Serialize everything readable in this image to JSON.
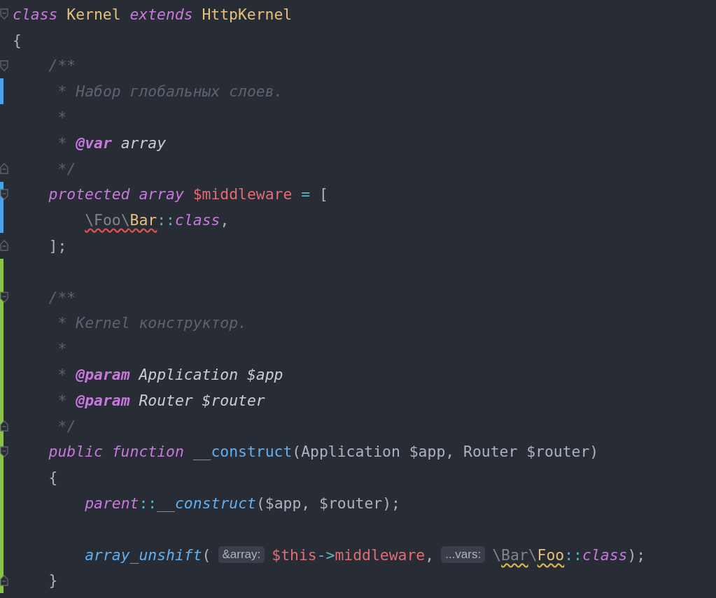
{
  "editor": {
    "lines": [
      {
        "kind": "top",
        "modified": false,
        "added": false,
        "fold_start": true,
        "fold_end": false,
        "segments": [
          {
            "kind": "code",
            "tokens": [
              {
                "text": "class ",
                "kind": "keyword"
              },
              {
                "text": "Kernel ",
                "kind": "class"
              },
              {
                "text": "extends ",
                "kind": "keyword"
              },
              {
                "text": "HttpKernel",
                "kind": "class"
              }
            ]
          }
        ]
      },
      {
        "kind": "top",
        "modified": false,
        "added": false,
        "fold_start": false,
        "fold_end": false,
        "segments": [
          {
            "kind": "code",
            "tokens": [
              {
                "text": "{",
                "kind": "punct"
              }
            ]
          }
        ]
      },
      {
        "kind": "member",
        "modified": false,
        "added": false,
        "fold_start": true,
        "fold_end": false,
        "segments": [
          {
            "kind": "code",
            "tokens": [
              {
                "text": "/**",
                "kind": "comment"
              }
            ]
          }
        ]
      },
      {
        "kind": "doc",
        "modified": true,
        "added": false,
        "fold_start": false,
        "fold_end": false,
        "segments": [
          {
            "kind": "code",
            "tokens": [
              {
                "text": "* Набор глобальных слоев.",
                "kind": "comment"
              }
            ]
          }
        ]
      },
      {
        "kind": "doc",
        "modified": false,
        "added": false,
        "fold_start": false,
        "fold_end": false,
        "segments": [
          {
            "kind": "code",
            "tokens": [
              {
                "text": "*",
                "kind": "comment"
              }
            ]
          }
        ]
      },
      {
        "kind": "doc",
        "modified": false,
        "added": false,
        "fold_start": false,
        "fold_end": false,
        "segments": [
          {
            "kind": "code",
            "tokens": [
              {
                "text": "* ",
                "kind": "comment"
              },
              {
                "text": "@var",
                "kind": "doctag"
              },
              {
                "text": " array",
                "kind": "doctype"
              }
            ]
          }
        ]
      },
      {
        "kind": "doc",
        "modified": false,
        "added": false,
        "fold_start": false,
        "fold_end": true,
        "segments": [
          {
            "kind": "code",
            "tokens": [
              {
                "text": "*/",
                "kind": "comment"
              }
            ]
          }
        ]
      },
      {
        "kind": "member",
        "modified": true,
        "added": false,
        "fold_start": true,
        "fold_end": false,
        "segments": [
          {
            "kind": "code",
            "tokens": [
              {
                "text": "protected array ",
                "kind": "keyword"
              },
              {
                "text": "$middleware ",
                "kind": "var"
              },
              {
                "text": "=",
                "kind": "op"
              },
              {
                "text": " [",
                "kind": "punct"
              }
            ]
          }
        ]
      },
      {
        "kind": "body",
        "modified": true,
        "added": false,
        "fold_start": false,
        "fold_end": false,
        "segments": [
          {
            "kind": "code",
            "tokens": [
              {
                "text": "\\Foo\\",
                "kind": "namespace-error"
              },
              {
                "text": "Bar",
                "kind": "class-error"
              },
              {
                "text": "::",
                "kind": "op"
              },
              {
                "text": "class",
                "kind": "keyword"
              },
              {
                "text": ",",
                "kind": "punct"
              }
            ]
          }
        ]
      },
      {
        "kind": "member",
        "modified": false,
        "added": false,
        "fold_start": false,
        "fold_end": true,
        "segments": [
          {
            "kind": "code",
            "tokens": [
              {
                "text": "];",
                "kind": "punct"
              }
            ]
          }
        ]
      },
      {
        "kind": "top",
        "modified": false,
        "added": true,
        "fold_start": false,
        "fold_end": false
      },
      {
        "kind": "member",
        "modified": false,
        "added": true,
        "fold_start": true,
        "fold_end": false,
        "segments": [
          {
            "kind": "code",
            "tokens": [
              {
                "text": "/**",
                "kind": "comment"
              }
            ]
          }
        ]
      },
      {
        "kind": "doc",
        "modified": false,
        "added": true,
        "fold_start": false,
        "fold_end": false,
        "segments": [
          {
            "kind": "code",
            "tokens": [
              {
                "text": "* Kernel конструктор.",
                "kind": "comment"
              }
            ]
          }
        ]
      },
      {
        "kind": "doc",
        "modified": false,
        "added": true,
        "fold_start": false,
        "fold_end": false,
        "segments": [
          {
            "kind": "code",
            "tokens": [
              {
                "text": "*",
                "kind": "comment"
              }
            ]
          }
        ]
      },
      {
        "kind": "doc",
        "modified": false,
        "added": true,
        "fold_start": false,
        "fold_end": false,
        "segments": [
          {
            "kind": "code",
            "tokens": [
              {
                "text": "* ",
                "kind": "comment"
              },
              {
                "text": "@param",
                "kind": "doctag"
              },
              {
                "text": " Application $app",
                "kind": "doctype"
              }
            ]
          }
        ]
      },
      {
        "kind": "doc",
        "modified": false,
        "added": true,
        "fold_start": false,
        "fold_end": false,
        "segments": [
          {
            "kind": "code",
            "tokens": [
              {
                "text": "* ",
                "kind": "comment"
              },
              {
                "text": "@param",
                "kind": "doctag"
              },
              {
                "text": " Router $router",
                "kind": "doctype"
              }
            ]
          }
        ]
      },
      {
        "kind": "doc",
        "modified": false,
        "added": true,
        "fold_start": false,
        "fold_end": true,
        "segments": [
          {
            "kind": "code",
            "tokens": [
              {
                "text": "*/",
                "kind": "comment"
              }
            ]
          }
        ]
      },
      {
        "kind": "member",
        "modified": false,
        "added": true,
        "fold_start": true,
        "fold_end": false,
        "segments": [
          {
            "kind": "code",
            "tokens": [
              {
                "text": "public function ",
                "kind": "keyword"
              },
              {
                "text": "__construct",
                "kind": "fn"
              },
              {
                "text": "(Application $app, Router $router)",
                "kind": "punct"
              }
            ]
          }
        ]
      },
      {
        "kind": "member",
        "modified": false,
        "added": true,
        "fold_start": false,
        "fold_end": false,
        "segments": [
          {
            "kind": "code",
            "tokens": [
              {
                "text": "{",
                "kind": "punct"
              }
            ]
          }
        ]
      },
      {
        "kind": "body",
        "modified": false,
        "added": true,
        "fold_start": false,
        "fold_end": false,
        "segments": [
          {
            "kind": "code",
            "tokens": [
              {
                "text": "parent",
                "kind": "keyword"
              },
              {
                "text": "::",
                "kind": "op"
              },
              {
                "text": "__construct",
                "kind": "fn-call"
              },
              {
                "text": "($app, $router);",
                "kind": "punct"
              }
            ]
          }
        ]
      },
      {
        "kind": "top",
        "modified": false,
        "added": true,
        "fold_start": false,
        "fold_end": false
      },
      {
        "kind": "body",
        "modified": false,
        "added": true,
        "fold_start": false,
        "fold_end": false,
        "segments": [
          {
            "kind": "code",
            "tokens": [
              {
                "text": "array_unshift",
                "kind": "fn-call"
              },
              {
                "text": "(",
                "kind": "punct"
              }
            ]
          },
          {
            "kind": "hint",
            "text": "&array:"
          },
          {
            "kind": "code",
            "tokens": [
              {
                "text": "$this",
                "kind": "var"
              },
              {
                "text": "->",
                "kind": "op"
              },
              {
                "text": "middleware",
                "kind": "var"
              },
              {
                "text": ",",
                "kind": "punct"
              }
            ]
          },
          {
            "kind": "hint",
            "text": "...vars:"
          },
          {
            "kind": "code",
            "tokens": [
              {
                "text": "\\",
                "kind": "namespace"
              },
              {
                "text": "Bar",
                "kind": "namespace-warning"
              },
              {
                "text": "\\",
                "kind": "namespace"
              },
              {
                "text": "Foo",
                "kind": "class-warning"
              },
              {
                "text": "::",
                "kind": "op"
              },
              {
                "text": "class",
                "kind": "keyword"
              },
              {
                "text": ");",
                "kind": "punct"
              }
            ]
          }
        ]
      },
      {
        "kind": "member",
        "modified": false,
        "added": true,
        "fold_start": false,
        "fold_end": true,
        "segments": [
          {
            "kind": "code",
            "tokens": [
              {
                "text": "}",
                "kind": "punct"
              }
            ]
          }
        ]
      }
    ]
  }
}
